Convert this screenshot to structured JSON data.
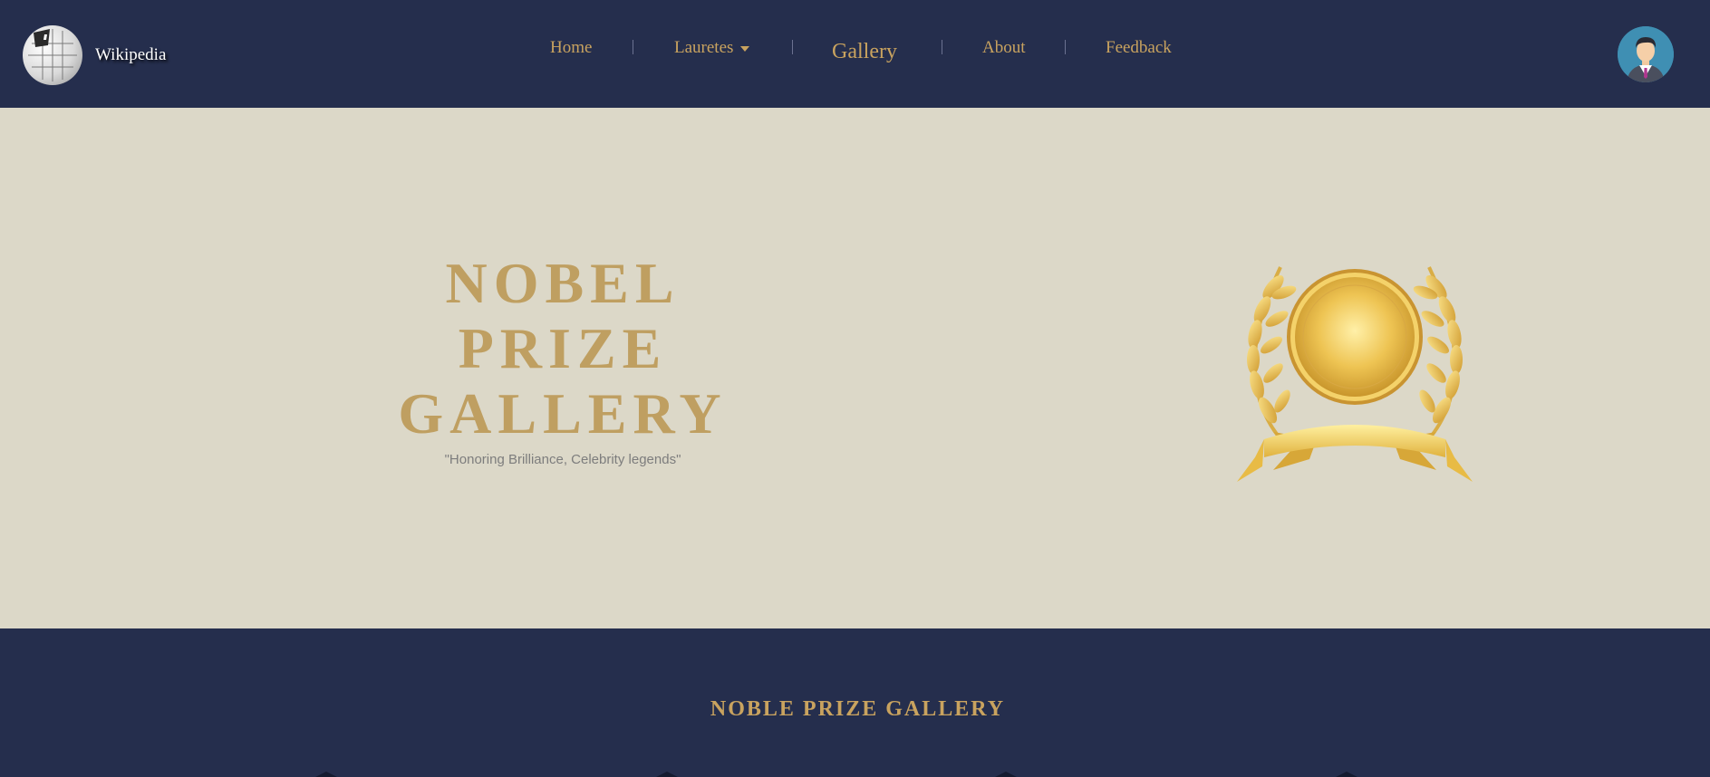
{
  "brand": {
    "name": "Wikipedia",
    "logo_icon": "wikipedia-globe-icon"
  },
  "nav": {
    "items": [
      {
        "label": "Home",
        "active": false
      },
      {
        "label": "Lauretes",
        "active": false,
        "has_dropdown": true
      },
      {
        "label": "Gallery",
        "active": true
      },
      {
        "label": "About",
        "active": false
      },
      {
        "label": "Feedback",
        "active": false
      }
    ],
    "avatar_icon": "user-avatar-icon"
  },
  "hero": {
    "title_lines": [
      "NOBEL",
      "PRIZE",
      "GALLERY"
    ],
    "tagline": "\"Honoring Brilliance, Celebrity legends\"",
    "image_icon": "gold-medal-laurel-icon"
  },
  "gallery_section": {
    "title": "NOBLE PRIZE GALLERY"
  },
  "colors": {
    "navbar_bg": "#252e4d",
    "hero_bg": "#dcd8c8",
    "accent_gold": "#bf9f61",
    "nav_text": "#c9a35f",
    "tagline_text": "#7d7d7d"
  }
}
